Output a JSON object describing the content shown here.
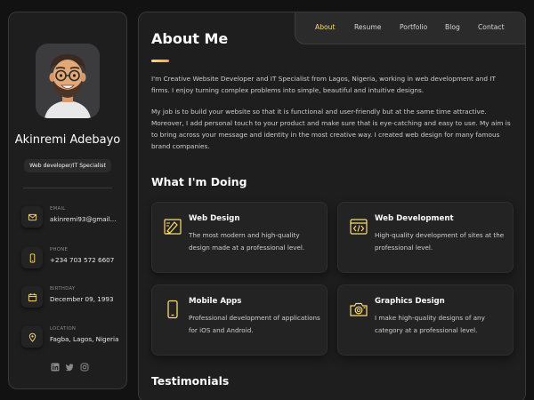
{
  "profile": {
    "name": "Akinremi Adebayo",
    "title": "Web developer/IT Specialist"
  },
  "contacts": [
    {
      "label": "EMAIL",
      "value": "akinremi93@gmail...",
      "icon": "mail-icon"
    },
    {
      "label": "PHONE",
      "value": "+234 703 572 6607",
      "icon": "phone-icon"
    },
    {
      "label": "BIRTHDAY",
      "value": "December 09, 1993",
      "icon": "calendar-icon"
    },
    {
      "label": "LOCATION",
      "value": "Fagba, Lagos, Nigeria",
      "icon": "location-pin-icon"
    }
  ],
  "socials": [
    "linkedin-icon",
    "twitter-icon",
    "instagram-icon"
  ],
  "nav": {
    "items": [
      "About",
      "Resume",
      "Portfolio",
      "Blog",
      "Contact"
    ],
    "active": "About"
  },
  "about": {
    "title": "About Me",
    "paragraphs": [
      "I'm Creative Website Developer and IT Specialist from Lagos, Nigeria, working in web development and IT firms. I enjoy turning complex problems into simple, beautiful and intuitive designs.",
      "My job is to build your website so that it is functional and user-friendly but at the same time attractive. Moreover, I add personal touch to your product and make sure that is eye-catching and easy to use. My aim is to bring across your message and identity in the most creative way. I created web design for many famous brand companies."
    ]
  },
  "services": {
    "title": "What I'm Doing",
    "items": [
      {
        "title": "Web Design",
        "desc": "The most modern and high-quality design made at a professional level.",
        "icon": "design-pen-icon"
      },
      {
        "title": "Web Development",
        "desc": "High-quality development of sites at the professional level.",
        "icon": "code-window-icon"
      },
      {
        "title": "Mobile Apps",
        "desc": "Professional development of applications for iOS and Android.",
        "icon": "smartphone-icon"
      },
      {
        "title": "Graphics Design",
        "desc": "I make high-quality designs of any category at a professional level.",
        "icon": "camera-icon"
      }
    ]
  },
  "testimonials": {
    "title": "Testimonials"
  },
  "colors": {
    "accent": "#ffdb70",
    "background": "#121212",
    "card": "#1e1e1f"
  }
}
